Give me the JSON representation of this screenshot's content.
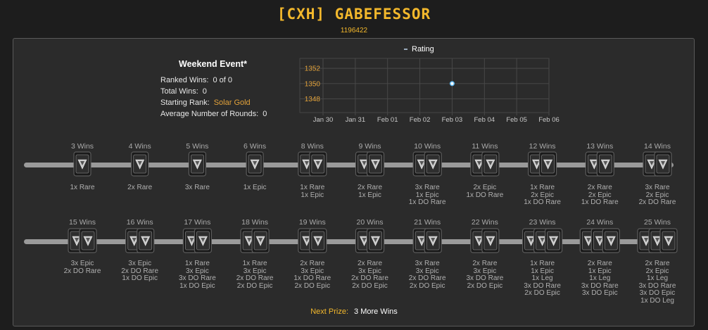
{
  "header": {
    "player_name": "[CXH] GABEFESSOR",
    "player_id": "1196422"
  },
  "event": {
    "title": "Weekend Event*",
    "stats": [
      {
        "label": "Ranked Wins:",
        "value": "0 of 0"
      },
      {
        "label": "Total Wins:",
        "value": "0"
      },
      {
        "label": "Starting Rank:",
        "value": "Solar Gold"
      },
      {
        "label": "Average Number of Rounds:",
        "value": "0"
      }
    ]
  },
  "colors": {
    "accent_gold": "#f3b82c",
    "rank_gold": "#e2a23a",
    "point": "#5ab4ee"
  },
  "chart_data": {
    "type": "line",
    "legend": "Rating",
    "x_ticks": [
      "Jan 30",
      "Jan 31",
      "Feb 01",
      "Feb 02",
      "Feb 03",
      "Feb 04",
      "Feb 05",
      "Feb 06"
    ],
    "y_ticks": [
      1352,
      1350,
      1348
    ],
    "ylim": [
      1346.2,
      1353.3
    ],
    "series": [
      {
        "name": "Rating",
        "points": [
          {
            "x": "Feb 03",
            "y": 1350
          }
        ]
      }
    ]
  },
  "milestones": [
    {
      "label": "3 Wins",
      "rewards": [
        "1x Rare"
      ],
      "crates": 1
    },
    {
      "label": "4 Wins",
      "rewards": [
        "2x Rare"
      ],
      "crates": 1
    },
    {
      "label": "5 Wins",
      "rewards": [
        "3x Rare"
      ],
      "crates": 1
    },
    {
      "label": "6 Wins",
      "rewards": [
        "1x Epic"
      ],
      "crates": 1
    },
    {
      "label": "8 Wins",
      "rewards": [
        "1x Rare",
        "1x Epic"
      ],
      "crates": 2
    },
    {
      "label": "9 Wins",
      "rewards": [
        "2x Rare",
        "1x Epic"
      ],
      "crates": 2
    },
    {
      "label": "10 Wins",
      "rewards": [
        "3x Rare",
        "1x Epic",
        "1x DO Rare"
      ],
      "crates": 2
    },
    {
      "label": "11 Wins",
      "rewards": [
        "2x Epic",
        "1x DO Rare"
      ],
      "crates": 2
    },
    {
      "label": "12 Wins",
      "rewards": [
        "1x Rare",
        "2x Epic",
        "1x DO Rare"
      ],
      "crates": 2
    },
    {
      "label": "13 Wins",
      "rewards": [
        "2x Rare",
        "2x Epic",
        "1x DO Rare"
      ],
      "crates": 2
    },
    {
      "label": "14 Wins",
      "rewards": [
        "3x Rare",
        "2x Epic",
        "2x DO Rare"
      ],
      "crates": 2
    },
    {
      "label": "15 Wins",
      "rewards": [
        "3x Epic",
        "2x DO Rare"
      ],
      "crates": 2
    },
    {
      "label": "16 Wins",
      "rewards": [
        "3x Epic",
        "2x DO Rare",
        "1x DO Epic"
      ],
      "crates": 2
    },
    {
      "label": "17 Wins",
      "rewards": [
        "1x Rare",
        "3x Epic",
        "3x DO Rare",
        "1x DO Epic"
      ],
      "crates": 2
    },
    {
      "label": "18 Wins",
      "rewards": [
        "1x Rare",
        "3x Epic",
        "2x DO Rare",
        "2x DO Epic"
      ],
      "crates": 2
    },
    {
      "label": "19 Wins",
      "rewards": [
        "2x Rare",
        "3x Epic",
        "1x DO Rare",
        "2x DO Epic"
      ],
      "crates": 2
    },
    {
      "label": "20 Wins",
      "rewards": [
        "2x Rare",
        "3x Epic",
        "2x DO Rare",
        "2x DO Epic"
      ],
      "crates": 2
    },
    {
      "label": "21 Wins",
      "rewards": [
        "3x Rare",
        "3x Epic",
        "2x DO Rare",
        "2x DO Epic"
      ],
      "crates": 2
    },
    {
      "label": "22 Wins",
      "rewards": [
        "2x Rare",
        "3x Epic",
        "3x DO Rare",
        "2x DO Epic"
      ],
      "crates": 2
    },
    {
      "label": "23 Wins",
      "rewards": [
        "1x Rare",
        "1x Epic",
        "1x Leg",
        "3x DO Rare",
        "2x DO Epic"
      ],
      "crates": 3
    },
    {
      "label": "24 Wins",
      "rewards": [
        "2x Rare",
        "1x Epic",
        "1x Leg",
        "3x DO Rare",
        "3x DO Epic"
      ],
      "crates": 3
    },
    {
      "label": "25 Wins",
      "rewards": [
        "2x Rare",
        "2x Epic",
        "1x Leg",
        "3x DO Rare",
        "3x DO Epic",
        "1x DO Leg"
      ],
      "crates": 3
    }
  ],
  "next_prize": {
    "label": "Next Prize:",
    "value": "3 More Wins"
  }
}
